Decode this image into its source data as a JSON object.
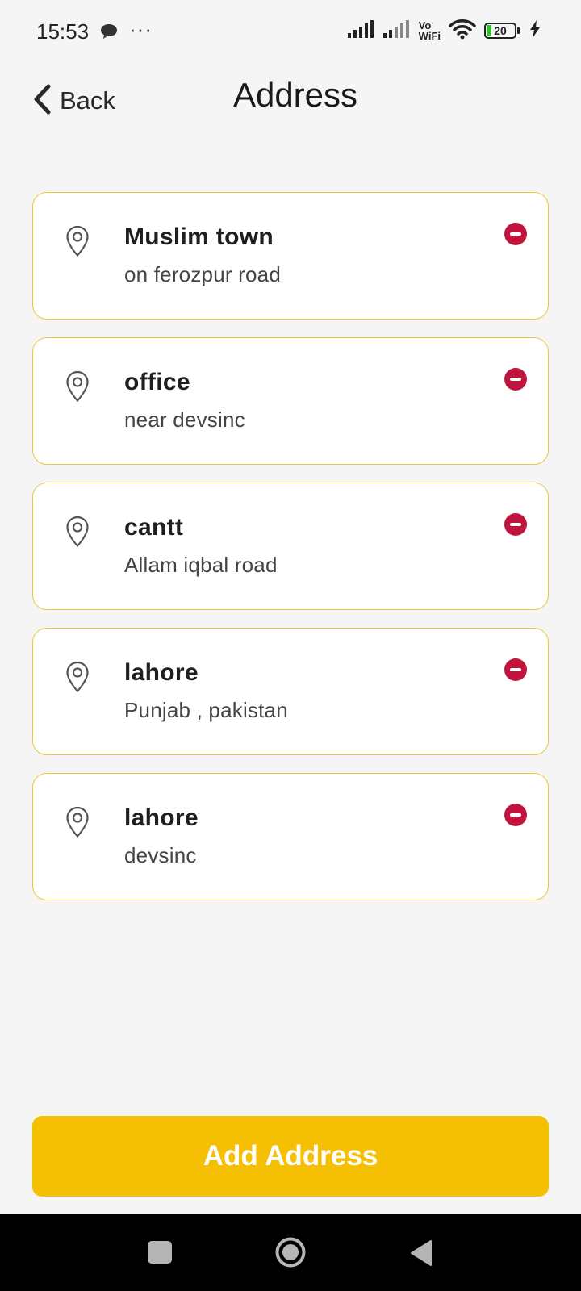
{
  "status_bar": {
    "time": "15:53",
    "dots": "···",
    "vowifi_top": "Vo",
    "vowifi_bottom": "WiFi",
    "battery_level": "20"
  },
  "header": {
    "back_label": "Back",
    "title": "Address"
  },
  "addresses": [
    {
      "title": "Muslim town",
      "subtitle": "on ferozpur road"
    },
    {
      "title": "office",
      "subtitle": "near devsinc"
    },
    {
      "title": "cantt",
      "subtitle": "Allam iqbal road"
    },
    {
      "title": "lahore",
      "subtitle": "Punjab , pakistan"
    },
    {
      "title": "lahore",
      "subtitle": "devsinc"
    }
  ],
  "footer": {
    "add_label": "Add Address"
  },
  "colors": {
    "accent": "#f5bf04",
    "card_border": "#e8c93a",
    "remove": "#c0143c",
    "background": "#f5f5f5"
  },
  "icons": {
    "back": "chevron-left-icon",
    "address": "map-pin-icon",
    "remove": "minus-circle-icon",
    "signal": "signal-icon",
    "wifi": "wifi-icon",
    "battery": "battery-icon",
    "charging": "lightning-icon",
    "message": "chat-bubble-icon"
  }
}
